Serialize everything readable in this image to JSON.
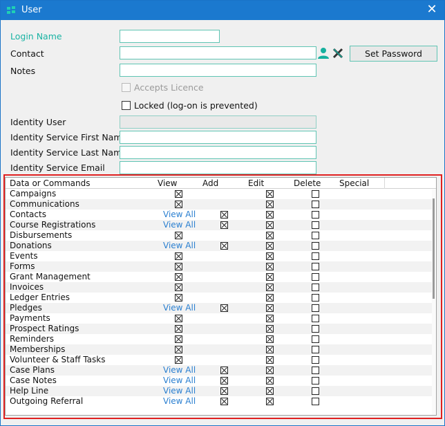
{
  "window": {
    "title": "User",
    "close_glyph": "✕",
    "app_icon": "grid-logo-icon",
    "accent": "#1b79cf"
  },
  "form": {
    "login_name": {
      "label": "Login Name",
      "value": ""
    },
    "contact": {
      "label": "Contact",
      "value": ""
    },
    "set_password_label": "Set Password",
    "notes": {
      "label": "Notes",
      "value": ""
    },
    "accepts_licence": {
      "label": "Accepts Licence",
      "checked": false,
      "enabled": false
    },
    "locked": {
      "label": "Locked (log-on is prevented)",
      "checked": false
    },
    "identity_user": {
      "label": "Identity User",
      "value": ""
    },
    "identity_first": {
      "label": "Identity Service First Name",
      "value": ""
    },
    "identity_last": {
      "label": "Identity Service Last Name",
      "value": ""
    },
    "identity_email": {
      "label": "Identity Service Email",
      "value": ""
    }
  },
  "permissions": {
    "columns": [
      "Data or Commands",
      "View",
      "Add",
      "Edit",
      "Delete",
      "Special"
    ],
    "rows": [
      {
        "name": "Campaigns",
        "view": true,
        "view_all": false,
        "add": null,
        "edit": true,
        "delete": false
      },
      {
        "name": "Communications",
        "view": true,
        "view_all": false,
        "add": null,
        "edit": true,
        "delete": false
      },
      {
        "name": "Contacts",
        "view": null,
        "view_all": true,
        "add": true,
        "edit": true,
        "delete": false
      },
      {
        "name": "Course Registrations",
        "view": null,
        "view_all": true,
        "add": true,
        "edit": true,
        "delete": false
      },
      {
        "name": "Disbursements",
        "view": true,
        "view_all": false,
        "add": null,
        "edit": true,
        "delete": false
      },
      {
        "name": "Donations",
        "view": null,
        "view_all": true,
        "add": true,
        "edit": true,
        "delete": false
      },
      {
        "name": "Events",
        "view": true,
        "view_all": false,
        "add": null,
        "edit": true,
        "delete": false
      },
      {
        "name": "Forms",
        "view": true,
        "view_all": false,
        "add": null,
        "edit": true,
        "delete": false
      },
      {
        "name": "Grant Management",
        "view": true,
        "view_all": false,
        "add": null,
        "edit": true,
        "delete": false
      },
      {
        "name": "Invoices",
        "view": true,
        "view_all": false,
        "add": null,
        "edit": true,
        "delete": false
      },
      {
        "name": "Ledger Entries",
        "view": true,
        "view_all": false,
        "add": null,
        "edit": true,
        "delete": false
      },
      {
        "name": "Pledges",
        "view": null,
        "view_all": true,
        "add": true,
        "edit": true,
        "delete": false
      },
      {
        "name": "Payments",
        "view": true,
        "view_all": false,
        "add": null,
        "edit": true,
        "delete": false
      },
      {
        "name": "Prospect Ratings",
        "view": true,
        "view_all": false,
        "add": null,
        "edit": true,
        "delete": false
      },
      {
        "name": "Reminders",
        "view": true,
        "view_all": false,
        "add": null,
        "edit": true,
        "delete": false
      },
      {
        "name": "Memberships",
        "view": true,
        "view_all": false,
        "add": null,
        "edit": true,
        "delete": false
      },
      {
        "name": "Volunteer & Staff Tasks",
        "view": true,
        "view_all": false,
        "add": null,
        "edit": true,
        "delete": false
      },
      {
        "name": "Case Plans",
        "view": null,
        "view_all": true,
        "add": true,
        "edit": true,
        "delete": false
      },
      {
        "name": "Case Notes",
        "view": null,
        "view_all": true,
        "add": true,
        "edit": true,
        "delete": false
      },
      {
        "name": "Help Line",
        "view": null,
        "view_all": true,
        "add": true,
        "edit": true,
        "delete": false
      },
      {
        "name": "Outgoing Referral",
        "view": null,
        "view_all": true,
        "add": true,
        "edit": true,
        "delete": false
      }
    ],
    "view_all_label": "View All",
    "highlight_color": "#e02020"
  }
}
